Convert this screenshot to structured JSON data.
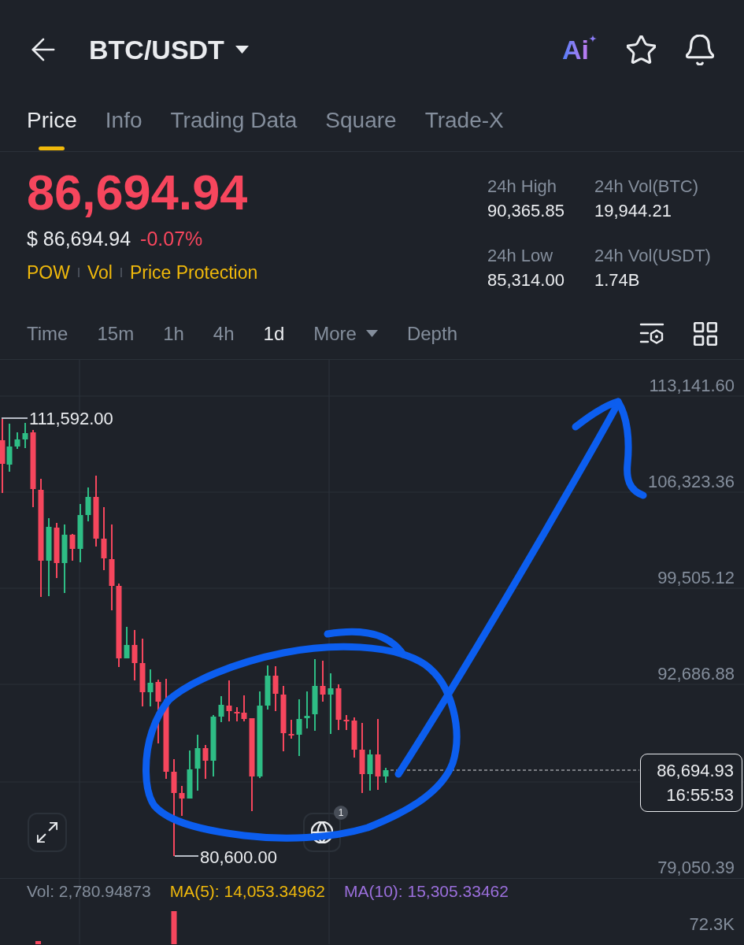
{
  "header": {
    "pair": "BTC/USDT",
    "ai_label": "Ai"
  },
  "tabs": [
    {
      "label": "Price",
      "selected": true
    },
    {
      "label": "Info",
      "selected": false
    },
    {
      "label": "Trading Data",
      "selected": false
    },
    {
      "label": "Square",
      "selected": false
    },
    {
      "label": "Trade-X",
      "selected": false
    }
  ],
  "price": {
    "last": "86,694.94",
    "falling": true,
    "fiat": "$ 86,694.94",
    "change": "-0.07%",
    "tags": [
      "POW",
      "Vol",
      "Price Protection"
    ]
  },
  "stats": [
    {
      "label": "24h High",
      "value": "90,365.85"
    },
    {
      "label": "24h Vol(BTC)",
      "value": "19,944.21"
    },
    {
      "label": "24h Low",
      "value": "85,314.00"
    },
    {
      "label": "24h Vol(USDT)",
      "value": "1.74B"
    }
  ],
  "intervals": [
    {
      "label": "Time",
      "selected": false,
      "kind": "option"
    },
    {
      "label": "15m",
      "selected": false,
      "kind": "option"
    },
    {
      "label": "1h",
      "selected": false,
      "kind": "option"
    },
    {
      "label": "4h",
      "selected": false,
      "kind": "option"
    },
    {
      "label": "1d",
      "selected": true,
      "kind": "option"
    },
    {
      "label": "More",
      "selected": false,
      "kind": "dropdown"
    },
    {
      "label": "Depth",
      "selected": false,
      "kind": "option"
    }
  ],
  "chart": {
    "price_axis": [
      "113,141.60",
      "106,323.36",
      "99,505.12",
      "92,686.88",
      "79,050.39"
    ],
    "high_label": "111,592.00",
    "low_label": "80,600.00",
    "last_price": {
      "price": "86,694.93",
      "time": "16:55:53"
    },
    "globe_badge": "1"
  },
  "volume": {
    "indicators": [
      {
        "label": "Vol: 2,780.94873",
        "color": "#848e9c"
      },
      {
        "label": "MA(5): 14,053.34962",
        "color": "#f0b90b"
      },
      {
        "label": "MA(10): 15,305.33462",
        "color": "#9b6fdc"
      }
    ],
    "axis_label": "72.3K"
  }
}
